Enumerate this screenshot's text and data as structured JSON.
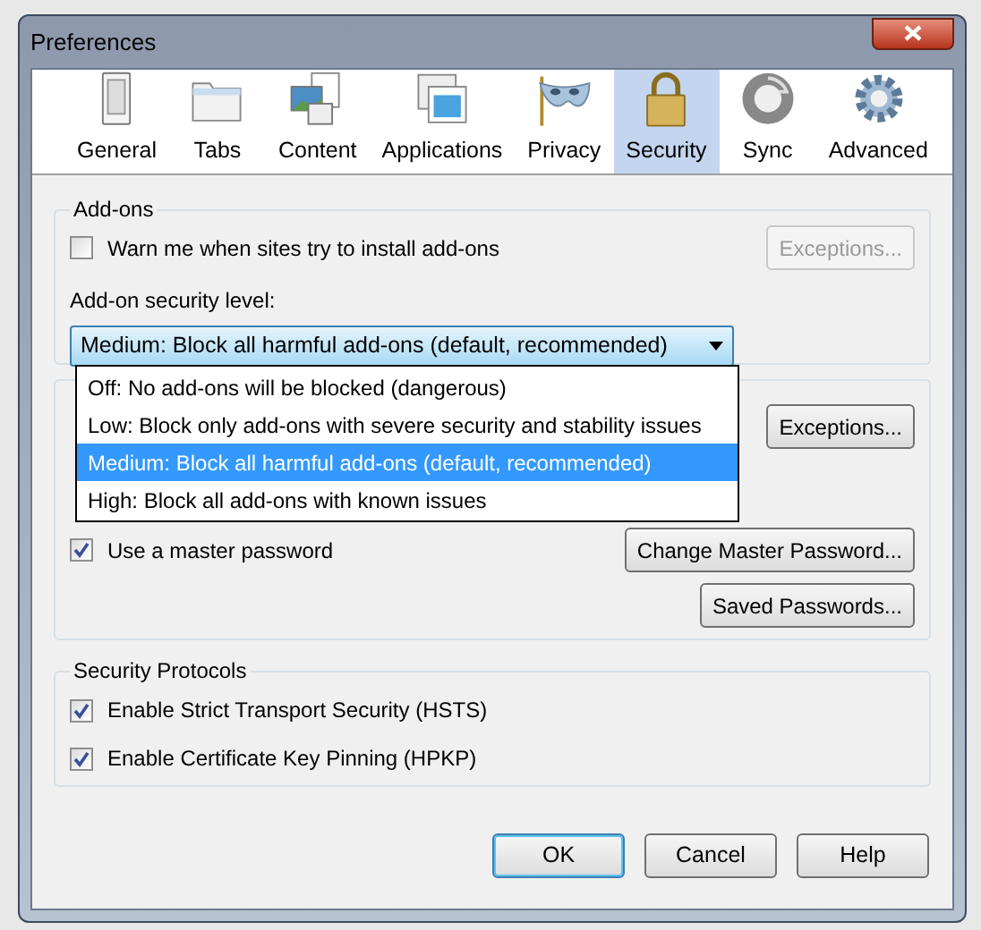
{
  "window": {
    "title": "Preferences"
  },
  "toolbar": [
    {
      "label": "General",
      "kind": "general",
      "selected": false
    },
    {
      "label": "Tabs",
      "kind": "tabs",
      "selected": false
    },
    {
      "label": "Content",
      "kind": "content",
      "selected": false
    },
    {
      "label": "Applications",
      "kind": "applications",
      "selected": false
    },
    {
      "label": "Privacy",
      "kind": "privacy",
      "selected": false
    },
    {
      "label": "Security",
      "kind": "security",
      "selected": true
    },
    {
      "label": "Sync",
      "kind": "sync",
      "selected": false
    },
    {
      "label": "Advanced",
      "kind": "advanced",
      "selected": false
    }
  ],
  "addons": {
    "title": "Add-ons",
    "warn": {
      "label": "Warn me when sites try to install add-ons",
      "checked": false
    },
    "exceptions": {
      "label": "Exceptions...",
      "disabled": true
    },
    "level_label": "Add-on security level:",
    "dropdown": {
      "value": "Medium: Block all harmful add-ons (default, recommended)",
      "expanded": true,
      "options": [
        {
          "label": "Off: No add-ons will be blocked (dangerous)",
          "selected": false
        },
        {
          "label": "Low: Block only add-ons with severe security and stability issues",
          "selected": false
        },
        {
          "label": "Medium: Block all harmful add-ons (default, recommended)",
          "selected": true
        },
        {
          "label": "High: Block all add-ons with known issues",
          "selected": false
        }
      ]
    }
  },
  "passwords": {
    "exceptions": {
      "label": "Exceptions...",
      "disabled": false
    },
    "master": {
      "label": "Use a master password",
      "checked": true
    },
    "change_button": "Change Master Password...",
    "saved_button": "Saved Passwords..."
  },
  "protocols": {
    "title": "Security Protocols",
    "items": [
      {
        "label": "Enable Strict Transport Security (HSTS)",
        "checked": true
      },
      {
        "label": "Enable Certificate Key Pinning (HPKP)",
        "checked": true
      }
    ]
  },
  "buttons": [
    {
      "label": "OK",
      "default": true
    },
    {
      "label": "Cancel",
      "default": false
    },
    {
      "label": "Help",
      "default": false
    }
  ]
}
